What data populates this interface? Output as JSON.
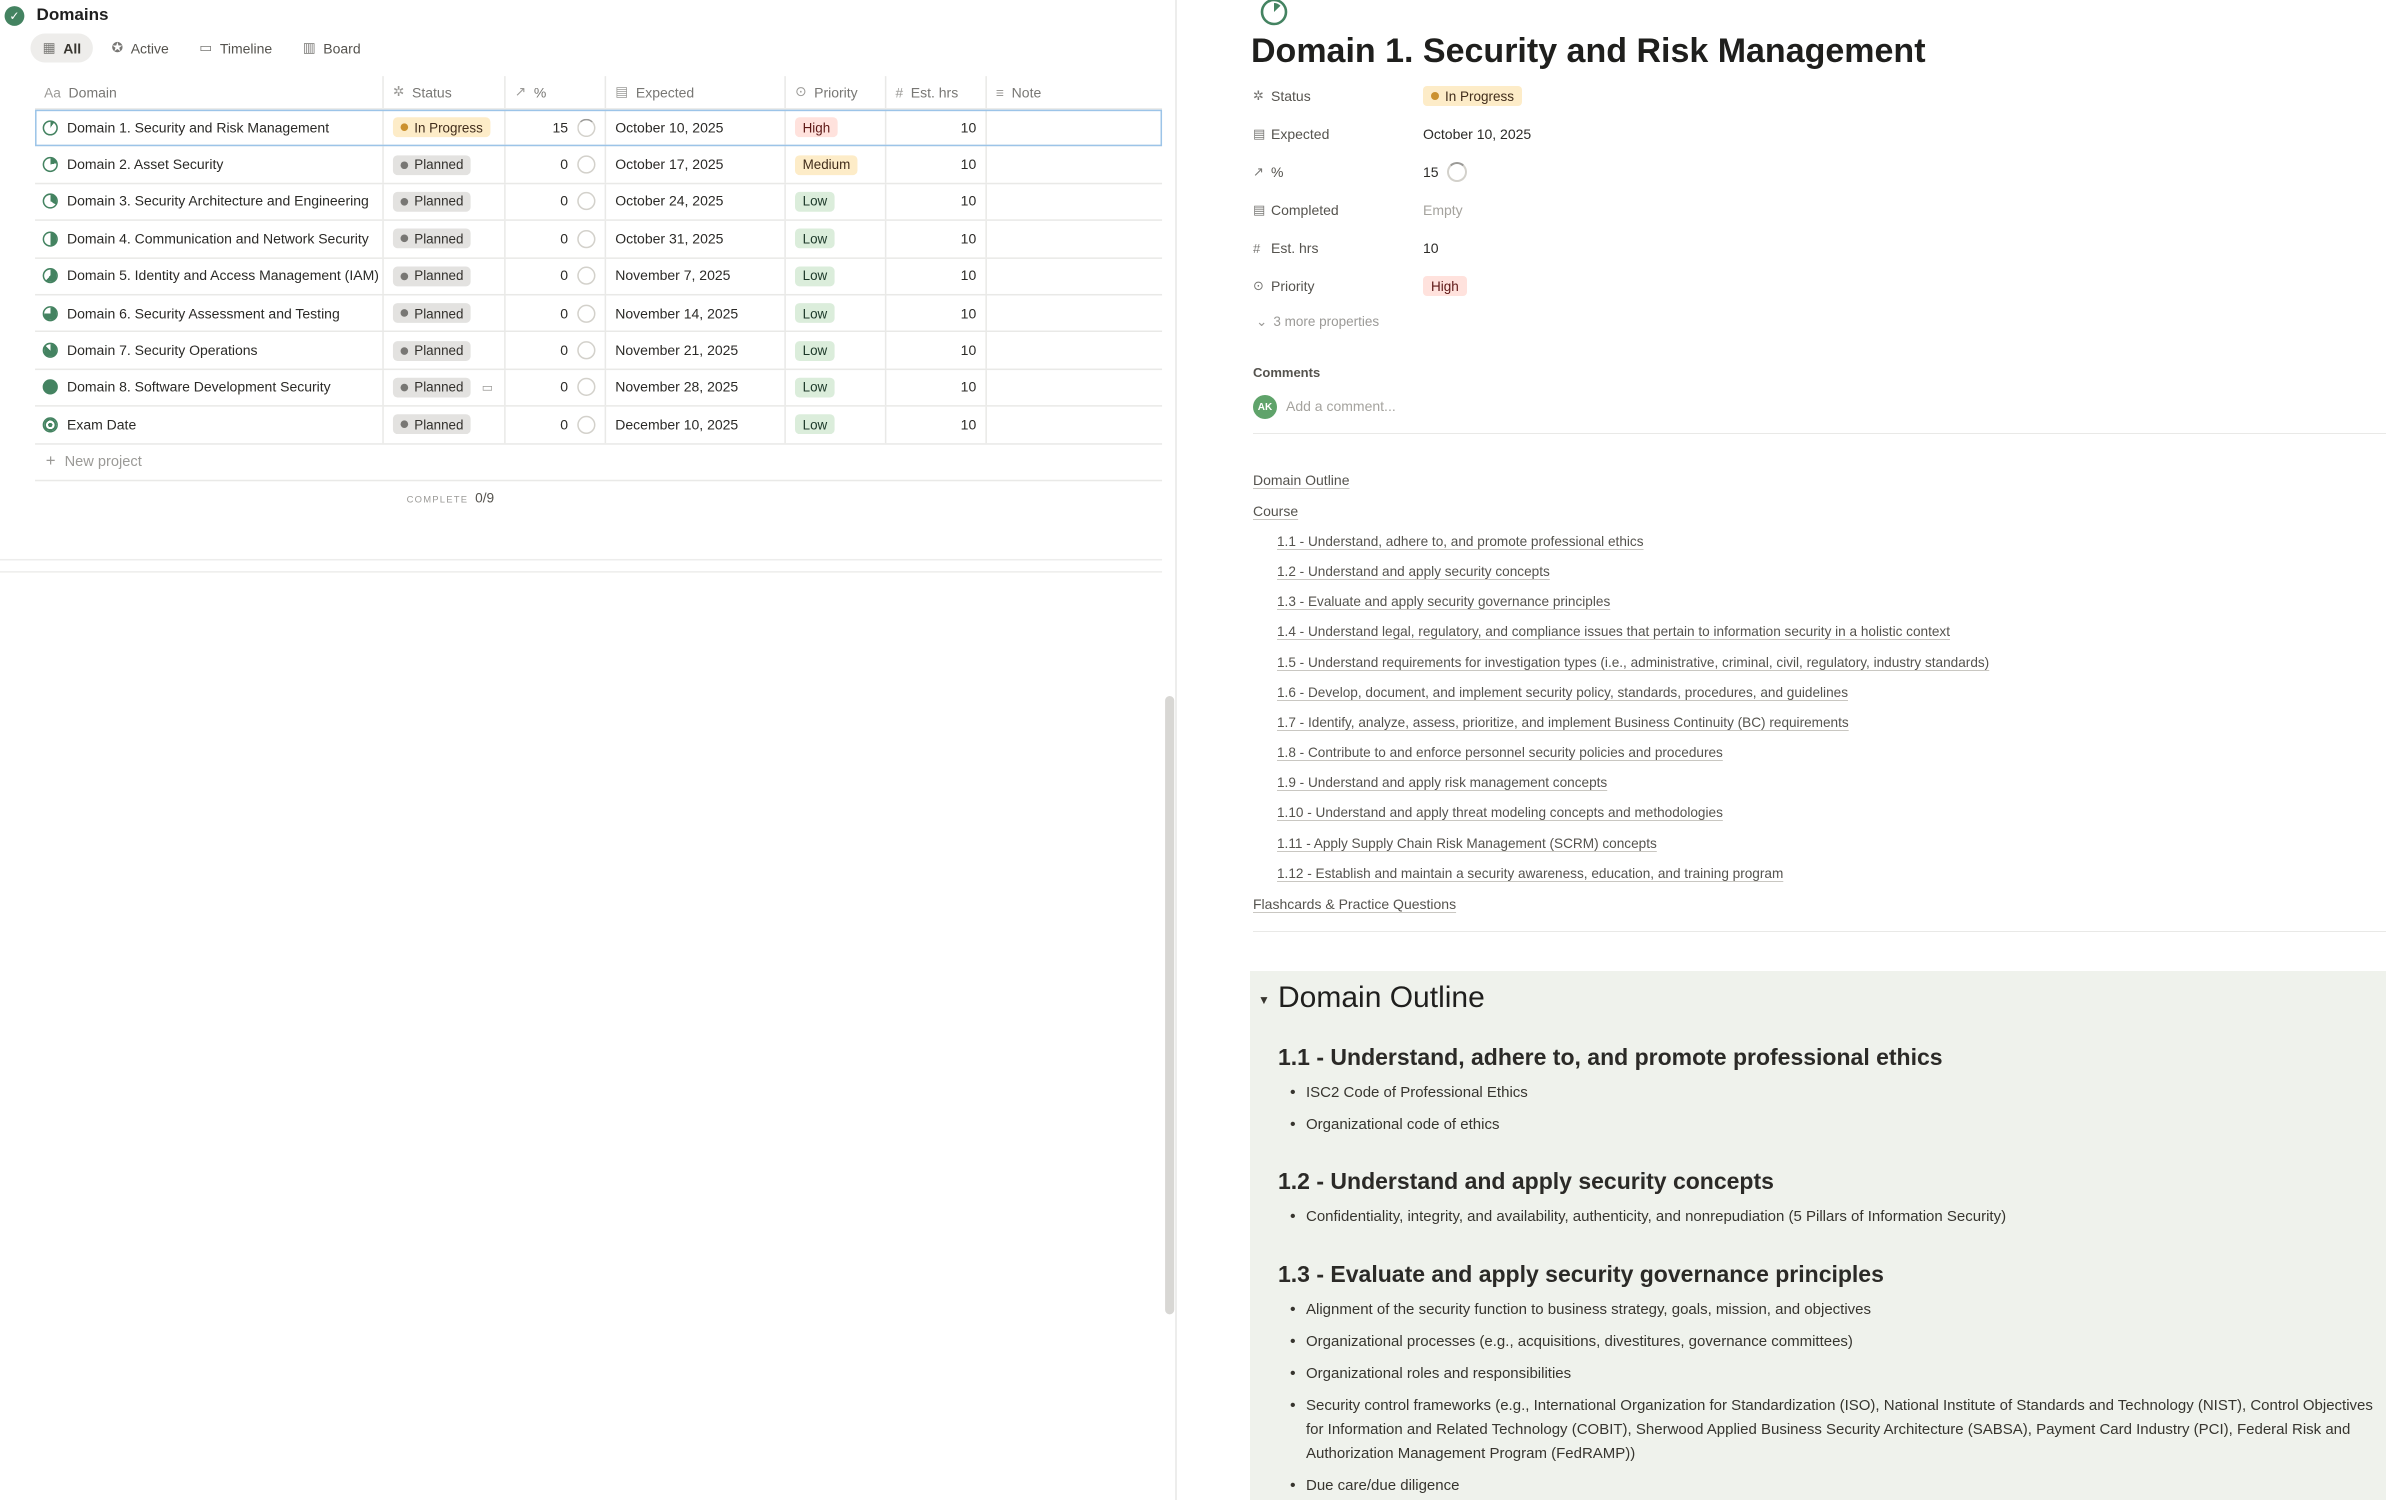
{
  "database": {
    "title": "Domains",
    "views": [
      {
        "label": "All",
        "icon": "table-icon",
        "active": true
      },
      {
        "label": "Active",
        "icon": "star-icon"
      },
      {
        "label": "Timeline",
        "icon": "timeline-icon"
      },
      {
        "label": "Board",
        "icon": "board-icon"
      }
    ],
    "columns": [
      "Domain",
      "Status",
      "%",
      "Expected",
      "Priority",
      "Est. hrs",
      "Note"
    ],
    "rows": [
      {
        "domain": "Domain 1. Security and Risk Management",
        "status": "In Progress",
        "pct": "15",
        "expected": "October 10, 2025",
        "priority": "High",
        "hrs": "10"
      },
      {
        "domain": "Domain 2. Asset Security",
        "status": "Planned",
        "pct": "0",
        "expected": "October 17, 2025",
        "priority": "Medium",
        "hrs": "10"
      },
      {
        "domain": "Domain 3. Security Architecture and Engineering",
        "status": "Planned",
        "pct": "0",
        "expected": "October 24, 2025",
        "priority": "Low",
        "hrs": "10"
      },
      {
        "domain": "Domain 4. Communication and Network Security",
        "status": "Planned",
        "pct": "0",
        "expected": "October 31, 2025",
        "priority": "Low",
        "hrs": "10"
      },
      {
        "domain": "Domain 5. Identity and Access Management (IAM)",
        "status": "Planned",
        "pct": "0",
        "expected": "November 7, 2025",
        "priority": "Low",
        "hrs": "10"
      },
      {
        "domain": "Domain 6. Security Assessment and Testing",
        "status": "Planned",
        "pct": "0",
        "expected": "November 14, 2025",
        "priority": "Low",
        "hrs": "10"
      },
      {
        "domain": "Domain 7. Security Operations",
        "status": "Planned",
        "pct": "0",
        "expected": "November 21, 2025",
        "priority": "Low",
        "hrs": "10"
      },
      {
        "domain": "Domain 8. Software Development Security",
        "status": "Planned",
        "pct": "0",
        "expected": "November 28, 2025",
        "priority": "Low",
        "hrs": "10"
      },
      {
        "domain": "Exam Date",
        "status": "Planned",
        "pct": "0",
        "expected": "December 10, 2025",
        "priority": "Low",
        "hrs": "10"
      }
    ],
    "new_row_label": "New project",
    "summary_label": "COMPLETE",
    "summary_value": "0/9"
  },
  "page": {
    "title": "Domain 1. Security and Risk Management",
    "props": {
      "status_label": "Status",
      "status_value": "In Progress",
      "expected_label": "Expected",
      "expected_value": "October 10, 2025",
      "pct_label": "%",
      "pct_value": "15",
      "completed_label": "Completed",
      "completed_value": "Empty",
      "hrs_label": "Est. hrs",
      "hrs_value": "10",
      "priority_label": "Priority",
      "priority_value": "High",
      "more_label": "3 more properties"
    },
    "comments_heading": "Comments",
    "avatar_initials": "AK",
    "comment_placeholder": "Add a comment...",
    "toc": {
      "outline": "Domain Outline",
      "course": "Course",
      "items": [
        "1.1 - Understand, adhere to, and promote professional ethics",
        "1.2 - Understand and apply security concepts",
        "1.3 - Evaluate and apply security governance principles",
        "1.4 - Understand legal, regulatory, and compliance issues that pertain to information security in a holistic context",
        "1.5 - Understand requirements for investigation types (i.e., administrative, criminal, civil, regulatory, industry standards)",
        "1.6 - Develop, document, and implement security policy, standards, procedures, and guidelines",
        "1.7 - Identify, analyze, assess, prioritize, and implement Business Continuity (BC) requirements",
        "1.8 - Contribute to and enforce personnel security policies and procedures",
        "1.9 - Understand and apply risk management concepts",
        "1.10 - Understand and apply threat modeling concepts and methodologies",
        "1.11 - Apply Supply Chain Risk Management (SCRM) concepts",
        "1.12 - Establish and maintain a security awareness, education, and training program"
      ],
      "flashcards": "Flashcards & Practice Questions"
    },
    "outline": {
      "heading": "Domain Outline",
      "h_1_1": "1.1 - Understand, adhere to, and promote professional ethics",
      "b_1_1": [
        "ISC2 Code of Professional Ethics",
        "Organizational code of ethics"
      ],
      "h_1_2": "1.2 - Understand and apply security concepts",
      "b_1_2": [
        "Confidentiality, integrity, and availability, authenticity, and nonrepudiation (5 Pillars of Information Security)"
      ],
      "h_1_3": "1.3 - Evaluate and apply security governance principles",
      "b_1_3": [
        "Alignment of the security function to business strategy, goals, mission, and objectives",
        "Organizational processes (e.g., acquisitions, divestitures, governance committees)",
        "Organizational roles and responsibilities",
        "Security control frameworks (e.g., International Organization for Standardization (ISO), National Institute of Standards and Technology (NIST), Control Objectives for Information and Related Technology (COBIT), Sherwood Applied Business Security Architecture (SABSA), Payment Card Industry (PCI), Federal Risk and Authorization Management Program (FedRAMP))",
        "Due care/due diligence"
      ]
    }
  },
  "colors": {
    "accent_green": "#448361",
    "in_progress_bg": "#fdecc8",
    "in_progress_dot": "#cb912f",
    "planned_bg": "#e3e2e0",
    "planned_dot": "#787774",
    "high_bg": "#ffe2dd",
    "high_fg": "#5d1715",
    "medium_bg": "#fdecc8",
    "medium_fg": "#402c1b",
    "low_bg": "#dbeddb",
    "low_fg": "#1c3829",
    "outline_bg": "#eff2ec"
  }
}
